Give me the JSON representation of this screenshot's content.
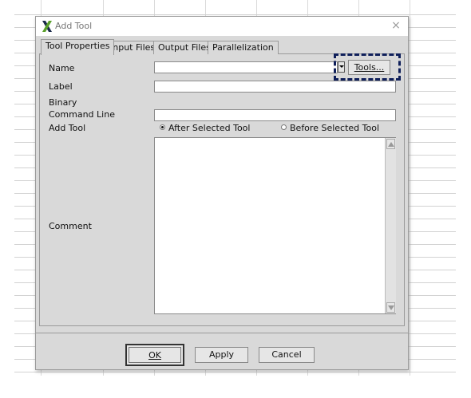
{
  "window": {
    "title": "Add Tool",
    "close_glyph": "×",
    "app_icon": "x-logo-icon"
  },
  "tabs": [
    {
      "label": "Tool Properties",
      "active": true
    },
    {
      "label": "Input Files",
      "active": false
    },
    {
      "label": "Output Files",
      "active": false
    },
    {
      "label": "Parallelization",
      "active": false
    }
  ],
  "form": {
    "name_label": "Name",
    "name_value": "",
    "tools_button_label": "Tools...",
    "label_label": "Label",
    "label_value": "",
    "binary_label": "Binary",
    "command_line_label": "Command Line",
    "command_line_value": "",
    "add_tool_label": "Add Tool",
    "after_selected_label": "After Selected Tool",
    "before_selected_label": "Before Selected Tool",
    "selected_option": "After Selected Tool",
    "comment_label": "Comment",
    "comment_value": ""
  },
  "footer": {
    "ok_label": "OK",
    "apply_label": "Apply",
    "cancel_label": "Cancel"
  },
  "colors": {
    "dialog_bg": "#d9d9d9",
    "highlight": "#0f1f5a",
    "logo_dark": "#1b2a4a",
    "logo_green": "#5aa02c"
  }
}
